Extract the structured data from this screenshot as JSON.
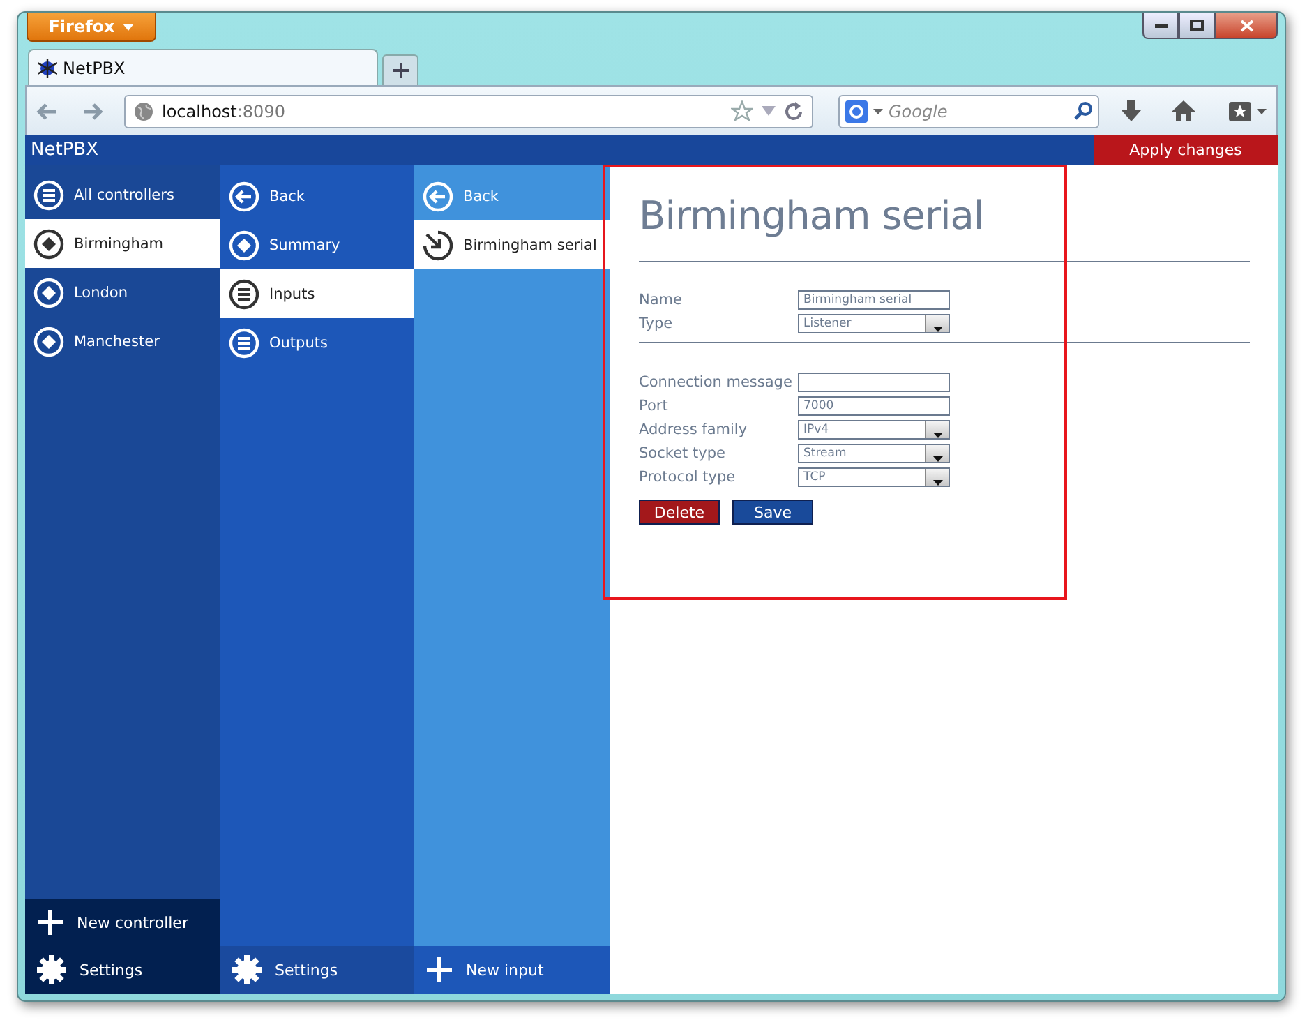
{
  "browser": {
    "app_menu": "Firefox",
    "tabs": [
      {
        "title": "NetPBX",
        "selected": true
      }
    ],
    "url": {
      "host": "localhost",
      "port": ":8090"
    },
    "search": {
      "placeholder": "Google"
    }
  },
  "app": {
    "title": "NetPBX",
    "apply_button": "Apply changes"
  },
  "columns": [
    {
      "items": [
        {
          "label": "All controllers",
          "kind": "list",
          "selected": false
        },
        {
          "label": "Birmingham",
          "kind": "diamond",
          "selected": true
        },
        {
          "label": "London",
          "kind": "diamond",
          "selected": false
        },
        {
          "label": "Manchester",
          "kind": "diamond",
          "selected": false
        }
      ],
      "footer": [
        {
          "label": "New controller",
          "kind": "plus"
        },
        {
          "label": "Settings",
          "kind": "gear"
        }
      ]
    },
    {
      "items": [
        {
          "label": "Back",
          "kind": "back",
          "selected": false
        },
        {
          "label": "Summary",
          "kind": "diamond",
          "selected": false
        },
        {
          "label": "Inputs",
          "kind": "list",
          "selected": true
        },
        {
          "label": "Outputs",
          "kind": "list",
          "selected": false
        }
      ],
      "footer": [
        {
          "label": "Settings",
          "kind": "gear"
        }
      ]
    },
    {
      "items": [
        {
          "label": "Back",
          "kind": "back",
          "selected": false
        },
        {
          "label": "Birmingham serial",
          "kind": "import",
          "selected": true
        }
      ],
      "footer": [
        {
          "label": "New input",
          "kind": "plus"
        }
      ]
    }
  ],
  "form": {
    "title": "Birmingham serial",
    "sections": [
      [
        {
          "label": "Name",
          "kind": "text",
          "value": "Birmingham serial"
        },
        {
          "label": "Type",
          "kind": "select",
          "value": "Listener"
        }
      ],
      [
        {
          "label": "Connection message",
          "kind": "text"
        },
        {
          "label": "Port",
          "kind": "text",
          "value": "7000"
        },
        {
          "label": "Address family",
          "kind": "select",
          "value": "IPv4"
        },
        {
          "label": "Socket type",
          "kind": "select",
          "value": "Stream"
        },
        {
          "label": "Protocol type",
          "kind": "select",
          "value": "TCP"
        }
      ]
    ],
    "buttons": [
      {
        "label": "Delete",
        "kind": "danger"
      },
      {
        "label": "Save",
        "kind": "primary"
      }
    ]
  }
}
